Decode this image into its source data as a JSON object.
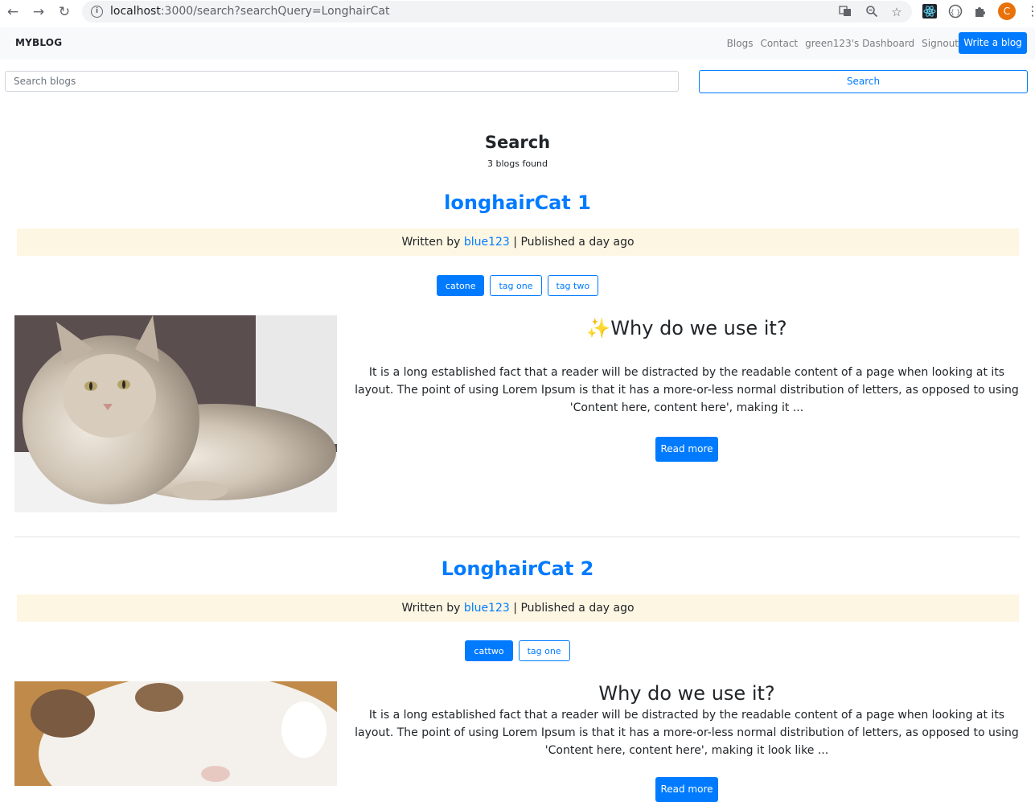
{
  "browser": {
    "back_icon": "arrow-left-icon",
    "forward_icon": "arrow-right-icon",
    "reload_icon": "reload-icon",
    "url_host": "localhost",
    "url_rest": ":3000/search?searchQuery=LonghairCat",
    "avatar_letter": "C"
  },
  "navbar": {
    "brand": "MYBLOG",
    "links": [
      "Blogs",
      "Contact",
      "green123's Dashboard",
      "Signout"
    ],
    "write_label": "Write a blog"
  },
  "search": {
    "placeholder": "Search blogs",
    "button_label": "Search"
  },
  "results": {
    "heading": "Search",
    "count_text": "3 blogs found"
  },
  "posts": [
    {
      "title": "longhairCat 1",
      "written_by": "Written by",
      "author": "blue123",
      "published": "| Published a day ago",
      "tags": [
        {
          "label": "catone",
          "primary": true
        },
        {
          "label": "tag one",
          "primary": false
        },
        {
          "label": "tag two",
          "primary": false
        }
      ],
      "heading_emoji": "✨",
      "heading": "Why do we use it?",
      "excerpt": "It is a long established fact that a reader will be distracted by the readable content of a page when looking at its layout. The point of using Lorem Ipsum is that it has a more-or-less normal distribution of letters, as opposed to using 'Content here, content here', making it ...",
      "read_more": "Read more"
    },
    {
      "title": "LonghairCat 2",
      "written_by": "Written by",
      "author": "blue123",
      "published": "| Published a day ago",
      "tags": [
        {
          "label": "cattwo",
          "primary": true
        },
        {
          "label": "tag one",
          "primary": false
        }
      ],
      "heading": "Why do we use it?",
      "excerpt": "It is a long established fact that a reader will be distracted by the readable content of a page when looking at its layout. The point of using Lorem Ipsum is that it has a more-or-less normal distribution of letters, as opposed to using 'Content here, content here', making it look like ...",
      "read_more": "Read more"
    }
  ],
  "colors": {
    "primary": "#007bff",
    "meta_bg": "#fdf6e3",
    "navbar_bg": "#f8f9fa"
  }
}
